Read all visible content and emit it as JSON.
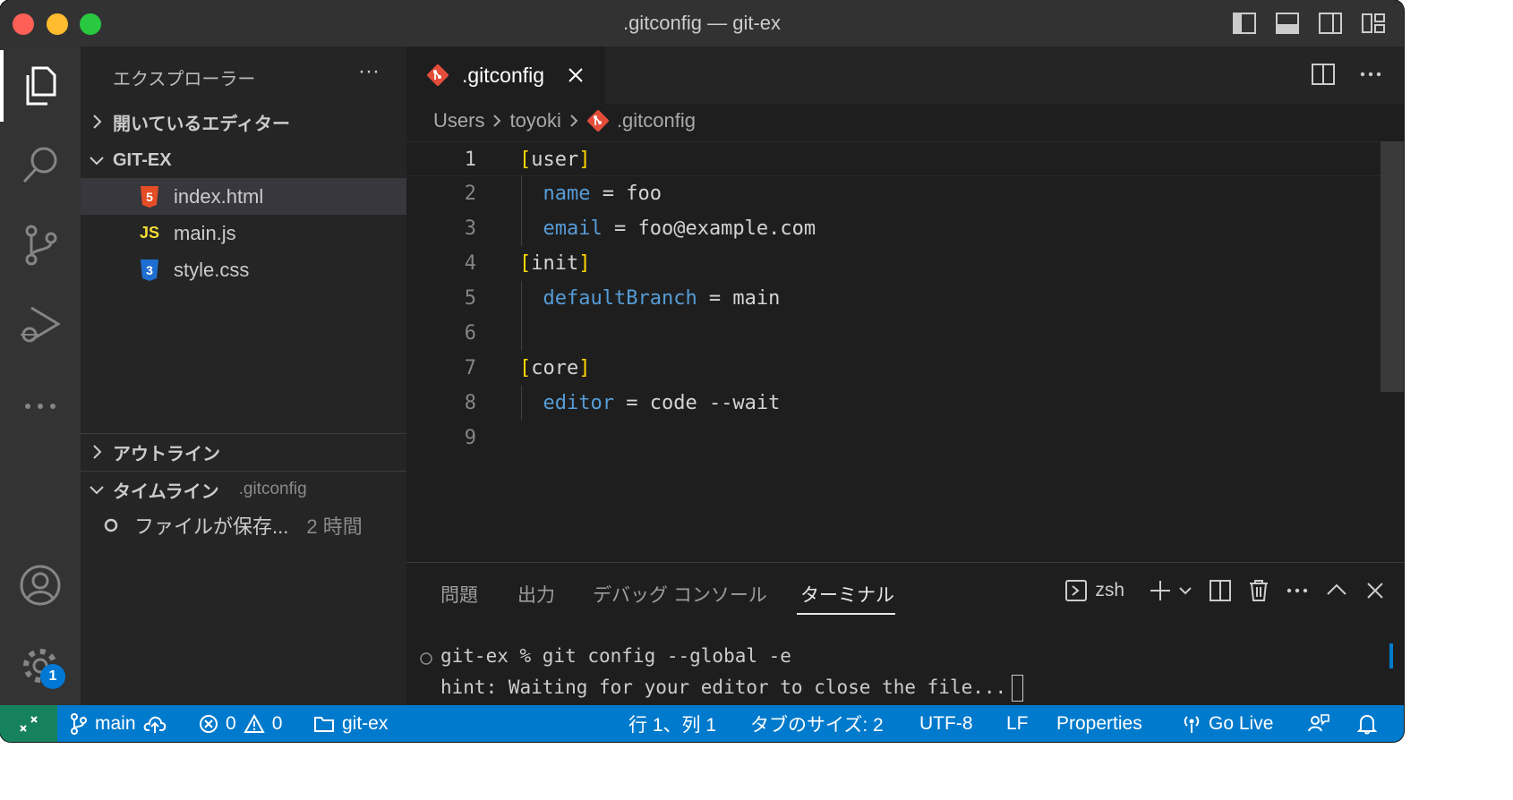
{
  "window": {
    "title": ".gitconfig — git-ex"
  },
  "explorer": {
    "title": "エクスプローラー",
    "more": "···",
    "open_editors": "開いているエディター",
    "folder": "GIT-EX",
    "files": [
      {
        "name": "index.html",
        "icon": "html5-icon",
        "icon_text": "5"
      },
      {
        "name": "main.js",
        "icon": "js-icon",
        "icon_text": "JS"
      },
      {
        "name": "style.css",
        "icon": "css3-icon",
        "icon_text": "3"
      }
    ],
    "outline": "アウトライン",
    "timeline": "タイムライン",
    "timeline_file": ".gitconfig",
    "timeline_item": "ファイルが保存...",
    "timeline_time": "2 時間"
  },
  "editor": {
    "tab_label": ".gitconfig",
    "breadcrumb": [
      "Users",
      "toyoki",
      ".gitconfig"
    ],
    "line_numbers": [
      "1",
      "2",
      "3",
      "4",
      "5",
      "6",
      "7",
      "8",
      "9"
    ],
    "lines": {
      "l1_section": "user",
      "l2_key": "name",
      "l2_val": " = foo",
      "l3_key": "email",
      "l3_val": " = foo@example.com",
      "l4_section": "init",
      "l5_key": "defaultBranch",
      "l5_val": " = main",
      "l7_section": "core",
      "l8_key": "editor",
      "l8_val": " = code --wait"
    }
  },
  "panel": {
    "tabs": [
      "問題",
      "出力",
      "デバッグ コンソール",
      "ターミナル"
    ],
    "shell": "zsh",
    "terminal_line1": "git-ex % git config --global -e",
    "terminal_line2": "hint: Waiting for your editor to close the file..."
  },
  "status": {
    "branch": "main",
    "errors": "0",
    "warnings": "0",
    "folder": "git-ex",
    "position": "行 1、列 1",
    "tab_size": "タブのサイズ: 2",
    "encoding": "UTF-8",
    "eol": "LF",
    "language": "Properties",
    "go_live": "Go Live",
    "settings_badge": "1"
  },
  "colors": {
    "accent": "#007acc",
    "remote": "#16825d",
    "bracket": "#ffd700",
    "key": "#569cd6",
    "git_icon": "#e44d3a"
  }
}
